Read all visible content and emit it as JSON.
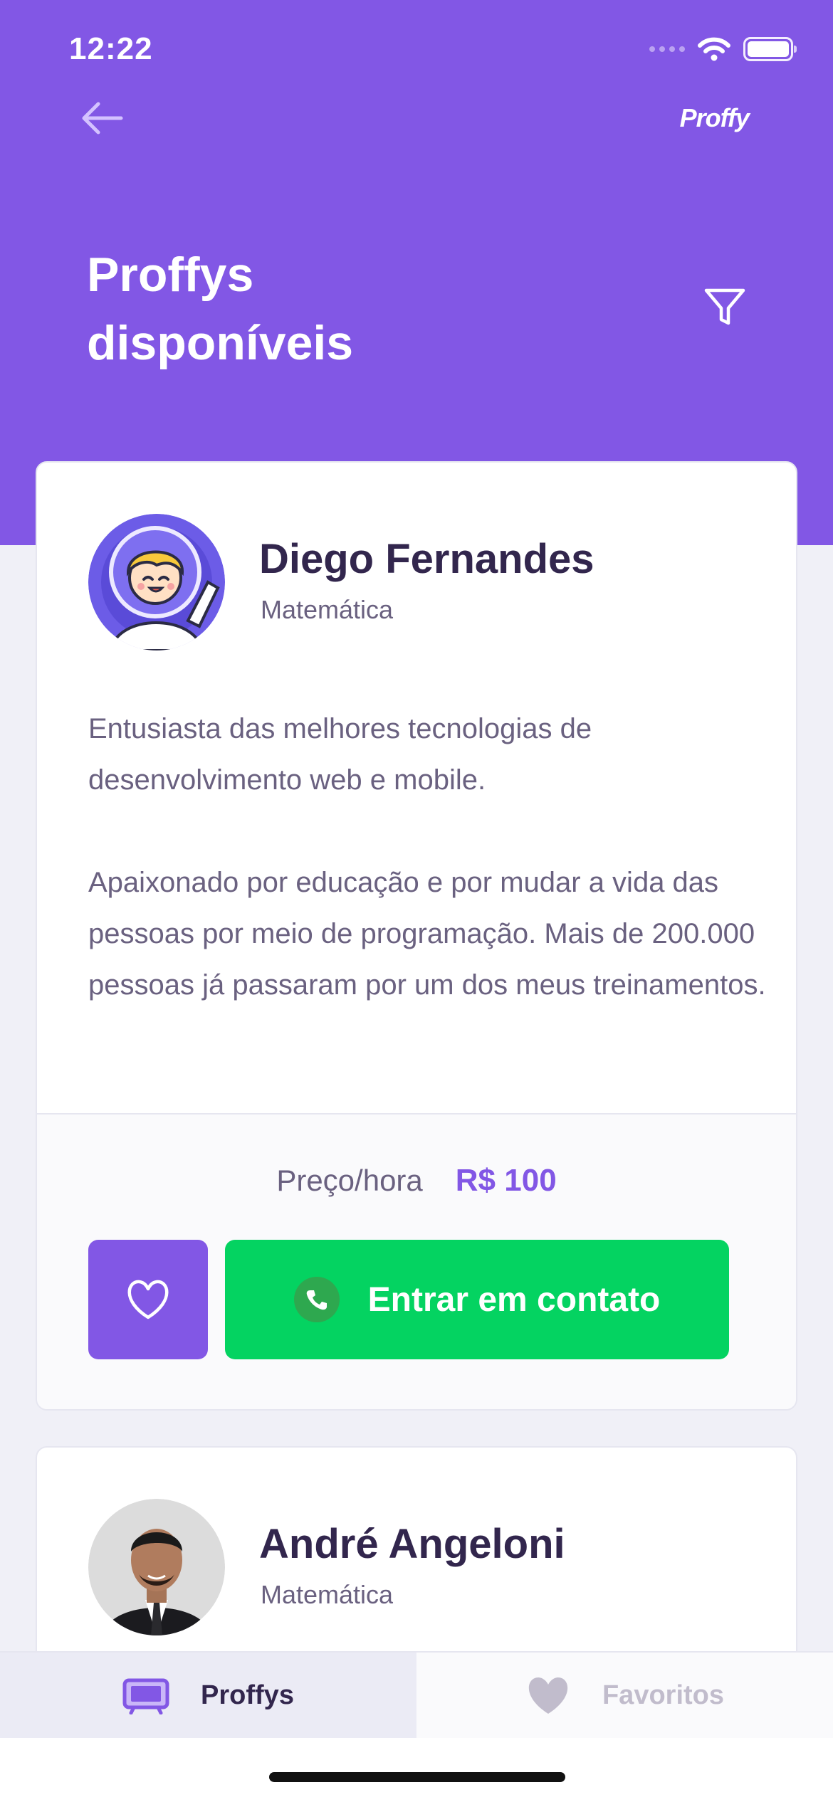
{
  "status_bar": {
    "time": "12:22"
  },
  "header": {
    "brand": "Proffy",
    "title_line1": "Proffys",
    "title_line2": "disponíveis"
  },
  "teachers": [
    {
      "name": "Diego Fernandes",
      "subject": "Matemática",
      "bio_paragraph_1": "Entusiasta das melhores tecnologias de desenvolvimento web e mobile.",
      "bio_paragraph_2": "Apaixonado por educação e por mudar a vida das pessoas por meio de programação. Mais de 200.000 pessoas já passaram por um dos meus treinamentos.",
      "price_label": "Preço/hora",
      "price_value": "R$ 100",
      "contact_label": "Entrar em contato"
    },
    {
      "name": "André Angeloni",
      "subject": "Matemática"
    }
  ],
  "tabs": [
    {
      "label": "Proffys",
      "active": true
    },
    {
      "label": "Favoritos",
      "active": false
    }
  ],
  "colors": {
    "primary": "#8257E5",
    "secondary": "#04D361",
    "title": "#32264D",
    "text": "#6A6180"
  }
}
